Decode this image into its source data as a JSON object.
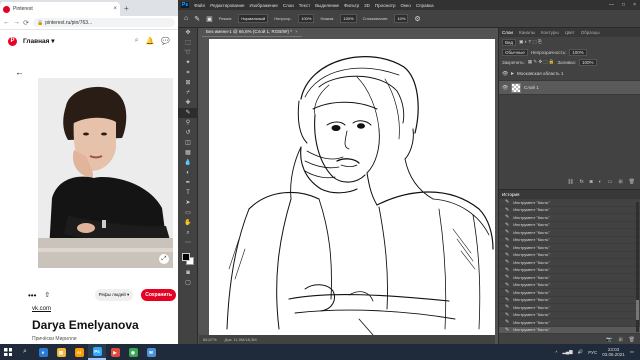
{
  "chrome": {
    "tab_title": "Pinterest",
    "tab_close": "×",
    "new_tab": "+",
    "url": "pinterest.ru/pin/763...",
    "nav": {
      "back": "←",
      "forward": "→",
      "reload": "⟳"
    }
  },
  "pinterest": {
    "home_label": "Главная ▾",
    "card_caption": "Darya Emelyanova",
    "board_select": "Рефы людей ▾",
    "save_button": "Сохранить",
    "source_link": "vk.com",
    "pin_title": "Darya Emelyanova",
    "pin_subtitle": "Причёски Мирилли"
  },
  "photoshop": {
    "menu": [
      "Файл",
      "Редактирование",
      "Изображение",
      "Слои",
      "Текст",
      "Выделение",
      "Фильтр",
      "3D",
      "Просмотр",
      "Окно",
      "Справка"
    ],
    "window_buttons": [
      "—",
      "□",
      "×"
    ],
    "options": {
      "mode_label": "Режим:",
      "mode_value": "Нормальный",
      "opacity_label": "Непрозр.:",
      "opacity_value": "100%",
      "flow_label": "Нажим:",
      "flow_value": "100%",
      "smoothing_label": "Сглаживание:",
      "smoothing_value": "10%"
    },
    "doc_tab": "Без имени-1 @ 66,6% (Слой 1, RGB/8#) *",
    "status": {
      "zoom": "66,67%",
      "doc_size": "Док: 11,9M/18,3M"
    },
    "layers_panel": {
      "tabs": [
        "Слои",
        "Каналы",
        "Контуры",
        "Цвет",
        "Образцы"
      ],
      "kind_select": "Вид",
      "blend_mode": "Обычные",
      "opacity_label": "Непрозрачность:",
      "opacity_value": "100%",
      "lock_label": "Закрепить:",
      "fill_label": "Заливка:",
      "fill_value": "100%",
      "group_name": "Московская область 1",
      "layer_name": "Слой 1"
    },
    "history_panel": {
      "tab": "История",
      "items": [
        "Инструмент \"Кисть\"",
        "Инструмент \"Кисть\"",
        "Инструмент \"Кисть\"",
        "Инструмент \"Кисть\"",
        "Инструмент \"Кисть\"",
        "Инструмент \"Кисть\"",
        "Инструмент \"Кисть\"",
        "Инструмент \"Кисть\"",
        "Инструмент \"Кисть\"",
        "Инструмент \"Кисть\"",
        "Инструмент \"Кисть\"",
        "Инструмент \"Кисть\"",
        "Инструмент \"Кисть\"",
        "Инструмент \"Кисть\"",
        "Инструмент \"Кисть\"",
        "Инструмент \"Кисть\"",
        "Инструмент \"Кисть\"",
        "Инструмент \"Кисть\""
      ]
    }
  },
  "taskbar": {
    "time": "23:03",
    "date": "03.06.2021",
    "lang": "РУС",
    "apps": [
      {
        "label": "e",
        "color": "#2b7bd6"
      },
      {
        "label": "▤",
        "color": "#f3b53f"
      },
      {
        "label": "Ai",
        "color": "#ff9a00"
      },
      {
        "label": "Ps",
        "color": "#31a8ff"
      },
      {
        "label": "▶",
        "color": "#e04a3f"
      },
      {
        "label": "◉",
        "color": "#3aa757"
      },
      {
        "label": "✉",
        "color": "#4a8fe0"
      }
    ]
  }
}
